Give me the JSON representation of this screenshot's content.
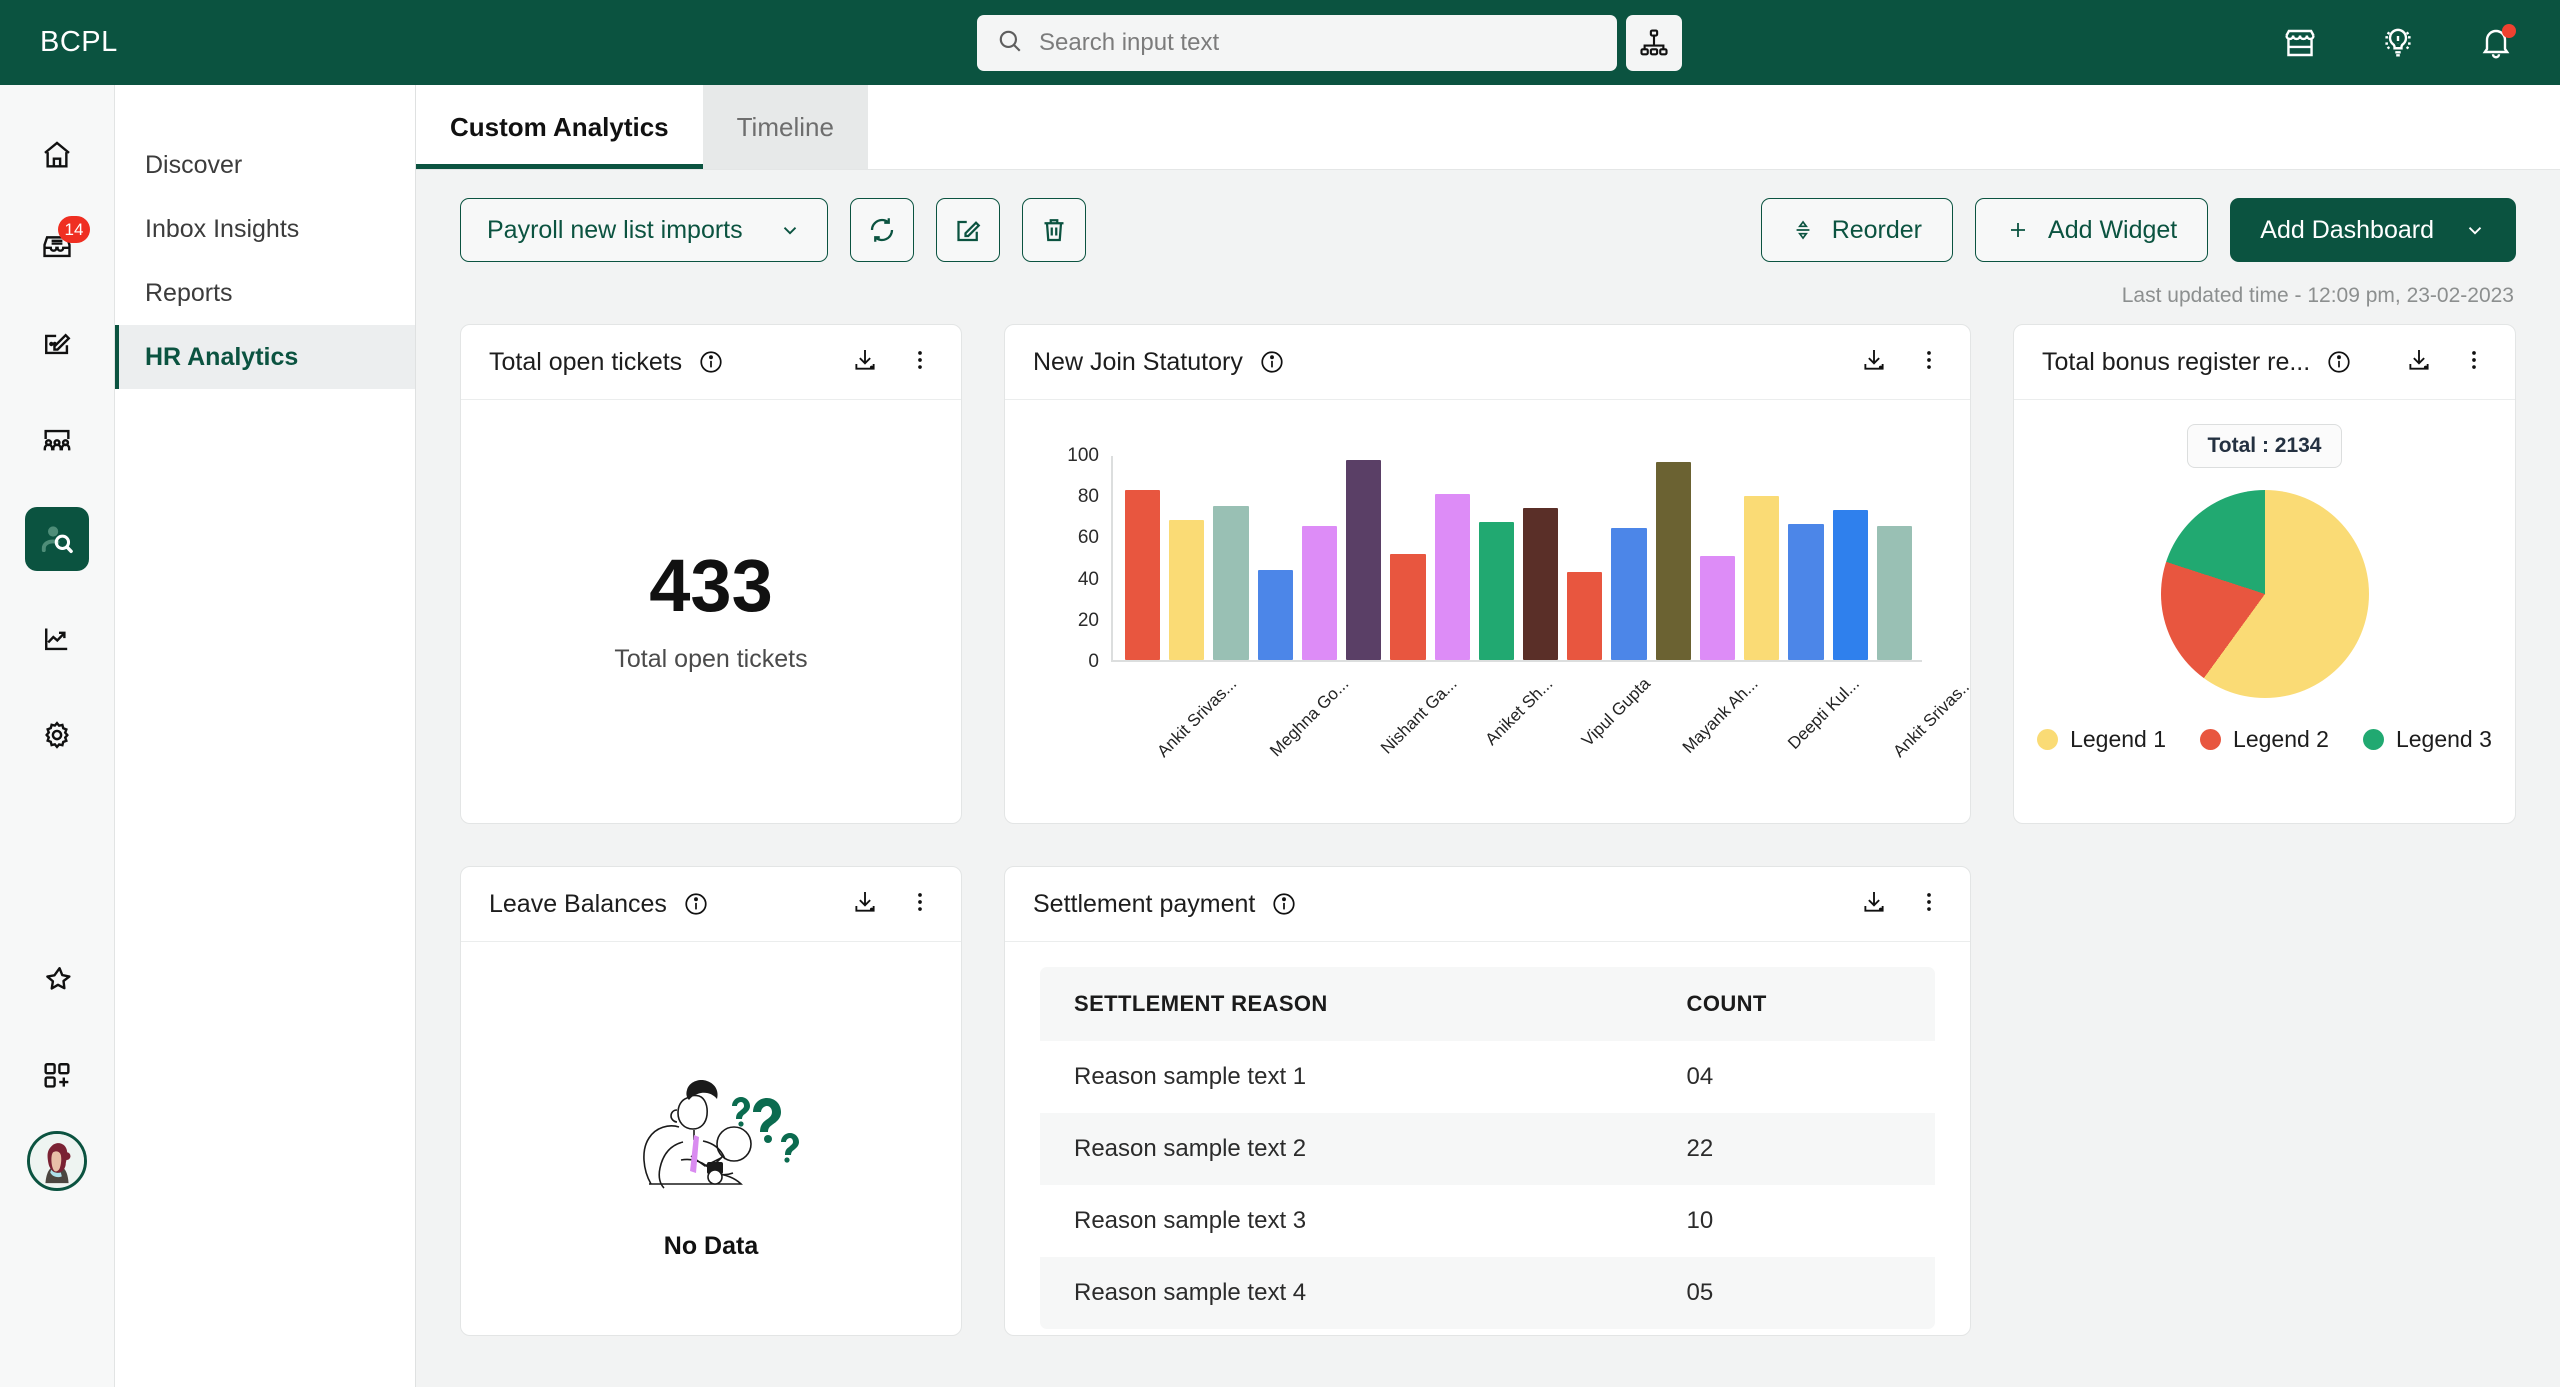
{
  "header": {
    "brand": "BCPL",
    "search": {
      "placeholder": "Search input text",
      "value": ""
    },
    "org_chart_icon": "org-chart-icon",
    "icons": [
      {
        "name": "storefront-icon",
        "label": "Marketplace"
      },
      {
        "name": "lightbulb-idea-icon",
        "label": "Insights"
      },
      {
        "name": "bell-notification-icon",
        "label": "Notifications",
        "has_dot": true
      }
    ]
  },
  "rail": {
    "items": [
      {
        "name": "home-icon",
        "label": "Home",
        "active": false,
        "badge": ""
      },
      {
        "name": "inbox-icon",
        "label": "Inbox",
        "active": false,
        "badge": "14"
      },
      {
        "name": "compose-edit-icon",
        "label": "Compose",
        "active": false,
        "badge": ""
      },
      {
        "name": "team-people-icon",
        "label": "Team",
        "active": false,
        "badge": ""
      },
      {
        "name": "person-search-icon",
        "label": "People Search",
        "active": true,
        "badge": ""
      },
      {
        "name": "trending-chart-icon",
        "label": "Analytics",
        "active": false,
        "badge": ""
      },
      {
        "name": "settings-gear-icon",
        "label": "Settings",
        "active": false,
        "badge": ""
      },
      {
        "name": "sparkle-magic-icon",
        "label": "Magic",
        "active": false,
        "badge": ""
      },
      {
        "name": "apps-grid-plus-icon",
        "label": "Add App",
        "active": false,
        "badge": ""
      }
    ]
  },
  "subnav": {
    "items": [
      {
        "label": "Discover",
        "active": false
      },
      {
        "label": "Inbox Insights",
        "active": false
      },
      {
        "label": "Reports",
        "active": false
      },
      {
        "label": "HR Analytics",
        "active": true
      }
    ]
  },
  "tabs": [
    {
      "label": "Custom Analytics",
      "active": true
    },
    {
      "label": "Timeline",
      "active": false
    }
  ],
  "toolbar": {
    "dashboard_select": "Payroll new list imports",
    "refresh_icon": "refresh-icon",
    "edit_icon": "edit-icon",
    "delete_icon": "trash-icon",
    "reorder_label": "Reorder",
    "add_widget_label": "Add Widget",
    "add_dashboard_label": "Add Dashboard"
  },
  "last_updated": "Last updated time - 12:09 pm, 23-02-2023",
  "widgets": {
    "total_open_tickets": {
      "title": "Total open tickets",
      "value": "433",
      "label": "Total open tickets"
    },
    "new_join_statutory": {
      "title": "New Join Statutory"
    },
    "total_bonus_register": {
      "title": "Total bonus register re...",
      "total_label": "Total : 2134"
    },
    "leave_balances": {
      "title": "Leave Balances",
      "empty_text": "No Data"
    },
    "settlement_payment": {
      "title": "Settlement payment",
      "columns": [
        "SETTLEMENT REASON",
        "COUNT"
      ],
      "rows": [
        [
          "Reason sample text 1",
          "04"
        ],
        [
          "Reason sample text 2",
          "22"
        ],
        [
          "Reason sample text 3",
          "10"
        ],
        [
          "Reason sample text 4",
          "05"
        ]
      ]
    }
  },
  "colors": {
    "brand_green": "#0b5340",
    "accent_red": "#ef2f22",
    "pie_yellow": "#fadb75",
    "pie_red": "#e8563f",
    "pie_green": "#21a971"
  },
  "chart_data": [
    {
      "type": "bar",
      "title": "New Join Statutory",
      "xlabel": "",
      "ylabel": "",
      "ylim": [
        0,
        100
      ],
      "yticks": [
        0,
        20,
        40,
        60,
        80,
        100
      ],
      "grid": false,
      "legend": "none",
      "categories": [
        "Ankit Srivas...",
        "Meghna Go...",
        "Nishant Ga...",
        "Aniket Sh...",
        "Vipul Gupta",
        "Mayank Ah...",
        "Deepti Kul...",
        "Ankit Srivas...",
        "Meghna Go...",
        "Nishant Ga...",
        "Aniket Sh...",
        "Vipul Gupta",
        "Mayank Ah...",
        "Deepti Kul...",
        "Ankit Srivas...",
        "Meghna Go...",
        "Nishant Ga...",
        "Vipul Gupta"
      ],
      "values": [
        85,
        70,
        77,
        45,
        67,
        100,
        53,
        83,
        69,
        76,
        44,
        66,
        99,
        52,
        82,
        68,
        75,
        67
      ],
      "bar_colors": [
        "#e8563f",
        "#fadb75",
        "#99c0b4",
        "#4c86e8",
        "#dd8cf7",
        "#5a3f66",
        "#e8563f",
        "#dd8cf7",
        "#21a971",
        "#5a2f28",
        "#e8563f",
        "#4c86e8",
        "#6b6232",
        "#dd8cf7",
        "#fadb75",
        "#4c86e8",
        "#2f80ed",
        "#99c0b4"
      ]
    },
    {
      "type": "pie",
      "title": "Total bonus register re...",
      "total": 2134,
      "labels": [
        "Legend 1",
        "Legend 2",
        "Legend 3"
      ],
      "values": [
        1280,
        427,
        427
      ],
      "percentages": [
        60,
        20,
        20
      ],
      "colors": [
        "#fadb75",
        "#e8563f",
        "#21a971"
      ],
      "legend": "bottom"
    },
    {
      "type": "table",
      "title": "Settlement payment",
      "columns": [
        "SETTLEMENT REASON",
        "COUNT"
      ],
      "rows": [
        [
          "Reason sample text 1",
          "04"
        ],
        [
          "Reason sample text 2",
          "22"
        ],
        [
          "Reason sample text 3",
          "10"
        ],
        [
          "Reason sample text 4",
          "05"
        ]
      ]
    }
  ]
}
